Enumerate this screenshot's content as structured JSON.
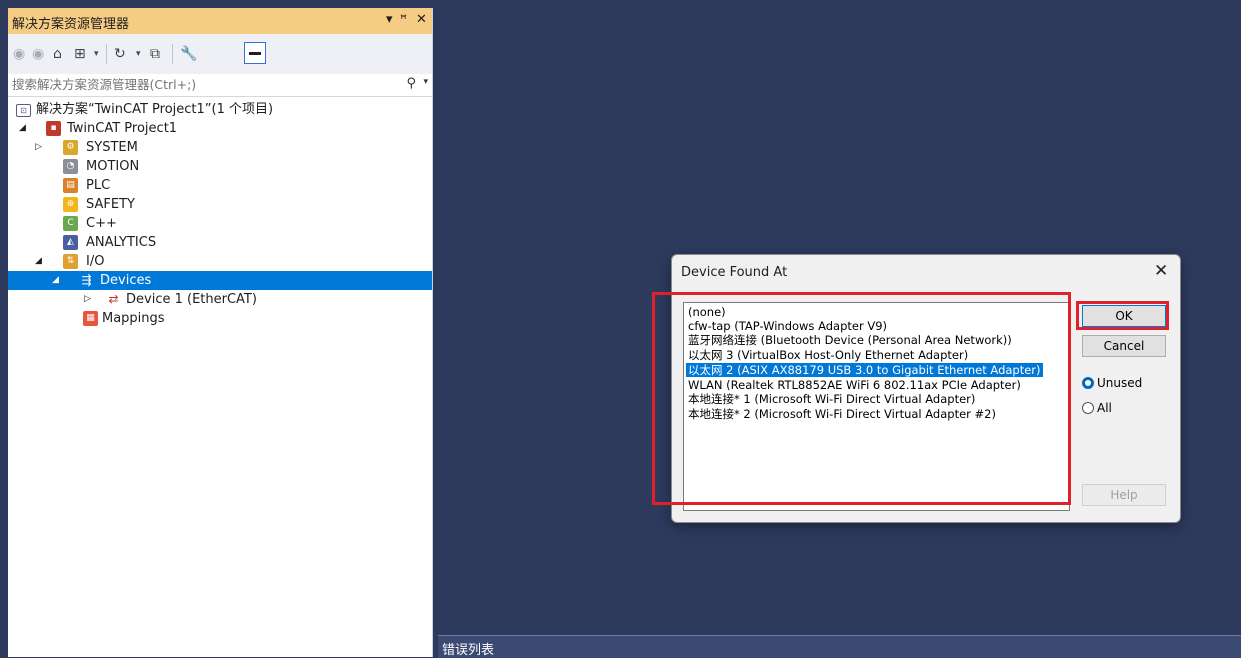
{
  "solution_explorer": {
    "title": "解决方案资源管理器",
    "title_controls": [
      "▾",
      "ᵖ",
      "✕"
    ],
    "search": {
      "placeholder": "搜索解决方案资源管理器(Ctrl+;)"
    },
    "tree": [
      {
        "label": "解决方案“TwinCAT Project1”(1 个项目)",
        "icon": "solution-icon"
      },
      {
        "label": "TwinCAT Project1",
        "icon": "twincat-project-icon"
      },
      {
        "label": "SYSTEM",
        "icon": "system-icon"
      },
      {
        "label": "MOTION",
        "icon": "motion-icon"
      },
      {
        "label": "PLC",
        "icon": "plc-icon"
      },
      {
        "label": "SAFETY",
        "icon": "safety-icon"
      },
      {
        "label": "C++",
        "icon": "cpp-icon"
      },
      {
        "label": "ANALYTICS",
        "icon": "analytics-icon"
      },
      {
        "label": "I/O",
        "icon": "io-icon"
      },
      {
        "label": "Devices",
        "icon": "devices-icon"
      },
      {
        "label": "Device 1 (EtherCAT)",
        "icon": "ethercat-device-icon"
      },
      {
        "label": "Mappings",
        "icon": "mappings-icon"
      }
    ]
  },
  "error_list": {
    "title": "错误列表"
  },
  "dialog": {
    "title": "Device Found At",
    "close_label": "✕",
    "adapters": [
      "(none)",
      "cfw-tap (TAP-Windows Adapter V9)",
      "蓝牙网络连接 (Bluetooth Device (Personal Area Network))",
      "以太网 3 (VirtualBox Host-Only Ethernet Adapter)",
      "以太网 2 (ASIX AX88179 USB 3.0 to Gigabit Ethernet Adapter)",
      "WLAN (Realtek RTL8852AE WiFi 6 802.11ax PCIe Adapter)",
      "本地连接* 1 (Microsoft Wi-Fi Direct Virtual Adapter)",
      "本地连接* 2 (Microsoft Wi-Fi Direct Virtual Adapter #2)"
    ],
    "selected_adapter": "以太网 2 (ASIX AX88179 USB 3.0 to Gigabit Ethernet Adapter)",
    "buttons": {
      "ok": "OK",
      "cancel": "Cancel",
      "help": "Help"
    },
    "radios": {
      "unused": "Unused",
      "all": "All",
      "selected": "Unused"
    }
  },
  "colors": {
    "selection": "#0078d7",
    "highlight_box": "#e0202a",
    "titlebar": "#f5cc84",
    "background": "#2d3a5e"
  }
}
